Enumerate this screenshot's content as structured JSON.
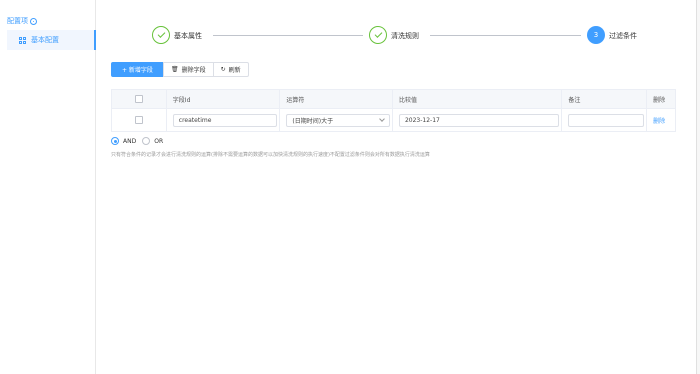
{
  "sidebar": {
    "header": "配置项",
    "items": [
      {
        "label": "基本配置"
      }
    ]
  },
  "steps": [
    {
      "label": "基本属性",
      "status": "done"
    },
    {
      "label": "清洗规则",
      "status": "done"
    },
    {
      "label": "过滤条件",
      "status": "active",
      "number": "3"
    }
  ],
  "toolbar": {
    "add_label": "+ 新增字段",
    "delete_label": "删除字段",
    "refresh_label": "刷新"
  },
  "table": {
    "headers": [
      "字段Id",
      "运算符",
      "比较值",
      "备注",
      "删除"
    ],
    "rows": [
      {
        "field": "createtime",
        "operator": "(日期时间)大于",
        "value": "2023-12-17",
        "remark": "",
        "action": "删除"
      }
    ]
  },
  "logic": {
    "options": [
      "AND",
      "OR"
    ],
    "selected": "AND"
  },
  "hint": "只有符合条件的记录才会进行清洗规则的运算(排除不需要运算的数据可以加快清洗规则的执行速度)不配置过滤条件则会对所有数据执行清洗运算",
  "colors": {
    "accent": "#409eff",
    "success": "#67c23a"
  }
}
